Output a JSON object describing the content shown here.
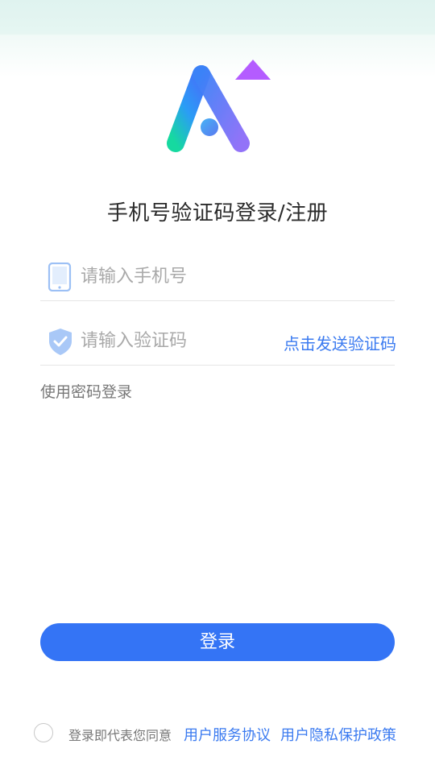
{
  "header": {
    "title": "手机号验证码登录/注册"
  },
  "form": {
    "phone": {
      "placeholder": "请输入手机号",
      "value": "",
      "icon": "phone-icon"
    },
    "code": {
      "placeholder": "请输入验证码",
      "value": "",
      "icon": "shield-check-icon",
      "send_label": "点击发送验证码"
    },
    "password_login_label": "使用密码登录",
    "submit_label": "登录"
  },
  "agreement": {
    "checked": false,
    "text": "登录即代表您同意",
    "service_link": "用户服务协议",
    "privacy_link": "用户隐私保护政策"
  },
  "colors": {
    "primary": "#3474f5",
    "link": "#3a7af0",
    "logo_gradient_start": "#18d6a0",
    "logo_gradient_end": "#b45cff",
    "header_band": "#dff3ef"
  }
}
